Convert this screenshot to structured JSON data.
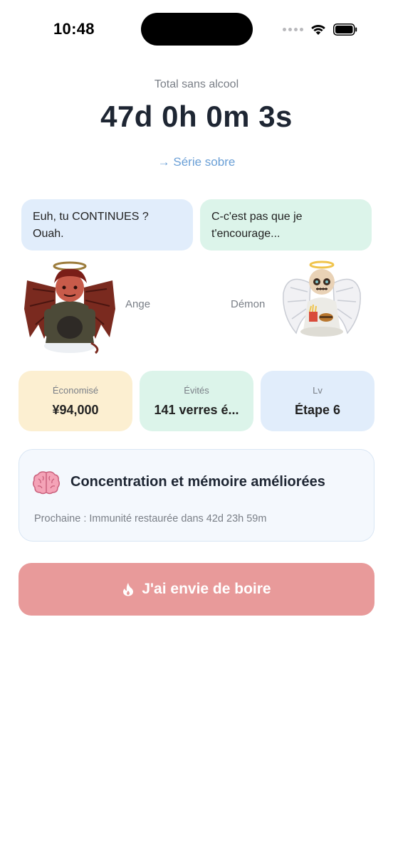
{
  "status_bar": {
    "time": "10:48"
  },
  "header": {
    "subtitle": "Total sans alcool",
    "timer": "47d 0h 0m 3s",
    "streak_link": "→ Série sobre"
  },
  "dialogue": {
    "left_bubble": "Euh, tu CONTINUES ? Ouah.",
    "right_bubble": "C-c'est pas que je t'encourage..."
  },
  "characters": {
    "left_label": "Ange",
    "right_label": "Démon"
  },
  "stats": [
    {
      "label": "Économisé",
      "value": "¥94,000"
    },
    {
      "label": "Évités",
      "value": "141 verres é..."
    },
    {
      "label": "Lv",
      "value": "Étape 6"
    }
  ],
  "milestone": {
    "icon": "brain-icon",
    "title": "Concentration et mémoire améliorées",
    "next": "Prochaine : Immunité restaurée dans 42d 23h 59m"
  },
  "craving_button": {
    "icon": "flame-icon",
    "label": "J'ai envie de boire"
  },
  "colors": {
    "accent_link": "#6a9fd6",
    "bubble_blue": "#e1edfb",
    "bubble_green": "#dcf4ea",
    "stat_yellow": "#fcefd1",
    "craving_red": "#e89a9a"
  }
}
